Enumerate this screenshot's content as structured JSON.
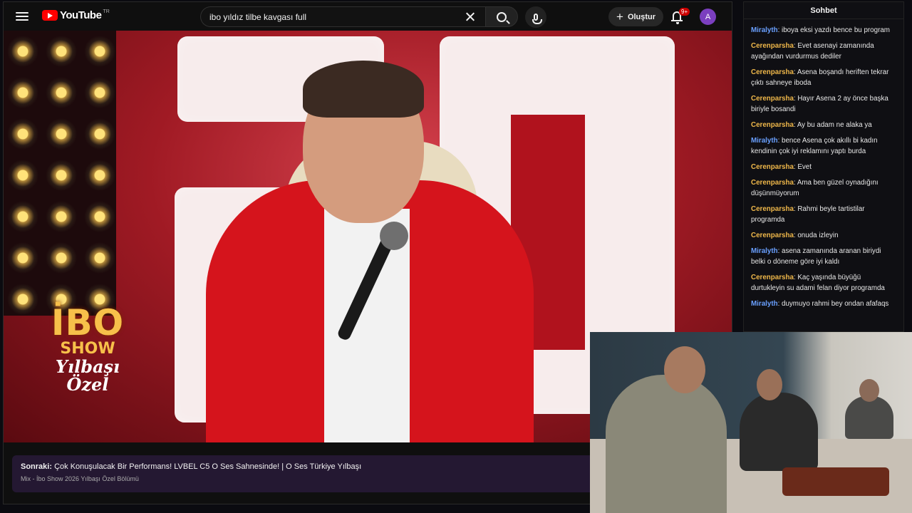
{
  "topbar": {
    "logo_text": "YouTube",
    "logo_country": "TR",
    "search_value": "ibo yıldız tilbe kavgası full",
    "create_label": "Oluştur",
    "notification_count": "9+",
    "avatar_letter": "A"
  },
  "video": {
    "show_title": "İBO",
    "show_subtitle": "SHOW",
    "show_script_1": "Yılbaşı",
    "show_script_2": "Özel"
  },
  "upnext": {
    "prefix": "Sonraki:",
    "title": "Çok Konuşulacak Bir Performans! LVBEL C5 O Ses Sahnesinde! | O Ses Türkiye Yılbaşı",
    "subtitle": "Mix - İbo Show 2026 Yılbaşı Özel Bölümü"
  },
  "chat": {
    "header": "Sohbet",
    "messages": [
      {
        "user": "Miralyth",
        "text": "iboya eksi yazdı bence bu program"
      },
      {
        "user": "Cerenparsha",
        "text": "Evet asenayi zamanında ayağından vurdurmus dediler"
      },
      {
        "user": "Cerenparsha",
        "text": "Asena boşandı heriften tekrar çıktı sahneye iboda"
      },
      {
        "user": "Cerenparsha",
        "text": "Hayır Asena 2 ay önce başka biriyle bosandi"
      },
      {
        "user": "Cerenparsha",
        "text": "Ay bu adam ne alaka ya"
      },
      {
        "user": "Miralyth",
        "text": "bence Asena çok akıllı bi kadın kendinin çok iyi reklamını yaptı burda"
      },
      {
        "user": "Cerenparsha",
        "text": "Evet"
      },
      {
        "user": "Cerenparsha",
        "text": "Ama ben güzel oynadığını düşünmüyorum"
      },
      {
        "user": "Cerenparsha",
        "text": "Rahmi beyle tartistilar programda"
      },
      {
        "user": "Cerenparsha",
        "text": "onuda izleyin"
      },
      {
        "user": "Miralyth",
        "text": "asena zamanında aranan biriydi belki o döneme göre iyi kaldı"
      },
      {
        "user": "Cerenparsha",
        "text": "Kaç yaşında büyüğü durtukleyin su adami felan diyor programda"
      },
      {
        "user": "Miralyth",
        "text": "duymuyo rahmi bey ondan afafaqs"
      }
    ]
  },
  "colors": {
    "youtube_red": "#ff0000",
    "chat_user_cerenparsha": "#f0b84a",
    "chat_user_miralyth": "#6aa0ff",
    "upnext_bg": "#241832"
  }
}
